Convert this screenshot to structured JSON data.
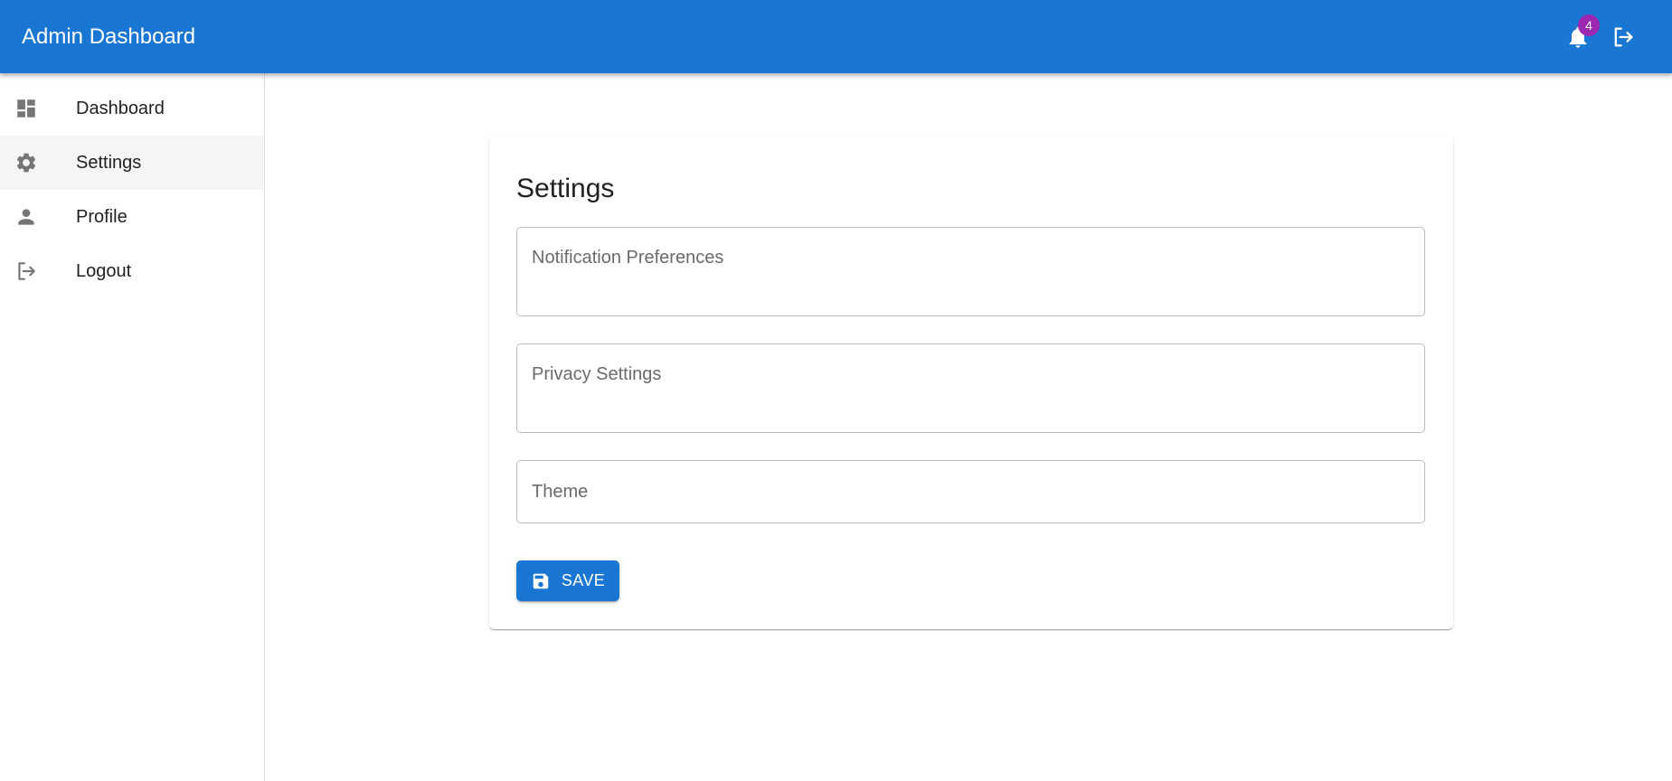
{
  "appbar": {
    "title": "Admin Dashboard",
    "notification_count": "4",
    "icons": [
      "bell-icon",
      "logout-icon"
    ]
  },
  "sidebar": {
    "items": [
      {
        "label": "Dashboard",
        "icon": "dashboard-icon"
      },
      {
        "label": "Settings",
        "icon": "gear-icon",
        "active": true
      },
      {
        "label": "Profile",
        "icon": "person-icon"
      },
      {
        "label": "Logout",
        "icon": "logout-icon"
      }
    ]
  },
  "settings": {
    "title": "Settings",
    "notification_placeholder": "Notification Preferences",
    "privacy_placeholder": "Privacy Settings",
    "theme_placeholder": "Theme",
    "save_label": "SAVE"
  },
  "colors": {
    "primary": "#1976d2",
    "badge": "#9c27b0",
    "icon_gray": "#757575"
  }
}
